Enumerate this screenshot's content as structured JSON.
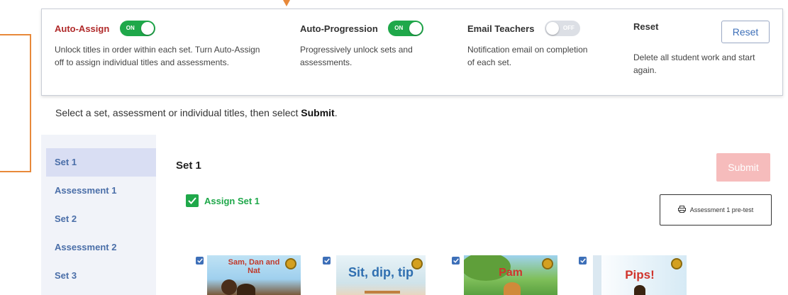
{
  "settings": {
    "auto_assign": {
      "title": "Auto-Assign",
      "toggle": "ON",
      "desc": "Unlock titles in order within each set. Turn Auto-Assign off to assign individual titles and assessments."
    },
    "auto_progression": {
      "title": "Auto-Progression",
      "toggle": "ON",
      "desc": "Progressively unlock sets and assessments."
    },
    "email_teachers": {
      "title": "Email Teachers",
      "toggle": "OFF",
      "desc": "Notification email on completion of each set."
    },
    "reset": {
      "title": "Reset",
      "button": "Reset",
      "desc": "Delete all student work and start again."
    }
  },
  "instruction": {
    "before": "Select a set, assessment or individual titles, then select ",
    "bold": "Submit",
    "after": "."
  },
  "sidebar": {
    "items": [
      {
        "label": "Set 1"
      },
      {
        "label": "Assessment 1"
      },
      {
        "label": "Set 2"
      },
      {
        "label": "Assessment 2"
      },
      {
        "label": "Set 3"
      }
    ]
  },
  "main": {
    "set_title": "Set 1",
    "submit_label": "Submit",
    "assign_label": "Assign Set 1",
    "pretest_label": "Assessment 1 pre-test",
    "books": [
      {
        "title": "Sam, Dan and Nat"
      },
      {
        "title": "Sit, dip, tip"
      },
      {
        "title": "Pam"
      },
      {
        "title": "Pips!"
      }
    ]
  },
  "colors": {
    "accent_green": "#1fa84a",
    "link_blue": "#4a6ea8",
    "callout_orange": "#e8893a",
    "submit_disabled": "#f6bcbc"
  }
}
